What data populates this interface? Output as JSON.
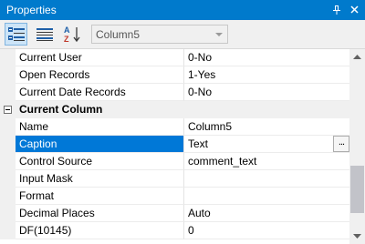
{
  "window": {
    "title": "Properties",
    "pin_icon": "pin-icon",
    "close_icon": "close-icon"
  },
  "toolbar": {
    "buttons": [
      {
        "icon": "categorized-view-icon",
        "active": true
      },
      {
        "icon": "property-pages-icon",
        "active": false
      },
      {
        "icon": "sort-alphabetical-icon",
        "active": false
      }
    ],
    "object_selector": {
      "value": "Column5",
      "options_visible": false
    }
  },
  "grid": {
    "rows": [
      {
        "type": "property",
        "name": "Current User",
        "value": "0-No"
      },
      {
        "type": "property",
        "name": "Open Records",
        "value": "1-Yes"
      },
      {
        "type": "property",
        "name": "Current Date Records",
        "value": "0-No"
      },
      {
        "type": "category",
        "name": "Current Column",
        "expanded": true
      },
      {
        "type": "property",
        "name": "Name",
        "value": "Column5"
      },
      {
        "type": "property",
        "name": "Caption",
        "value": "Text",
        "selected": true,
        "has_ellipsis": true,
        "ellipsis_label": "..."
      },
      {
        "type": "property",
        "name": "Control Source",
        "value": "comment_text"
      },
      {
        "type": "property",
        "name": "Input Mask",
        "value": ""
      },
      {
        "type": "property",
        "name": "Format",
        "value": ""
      },
      {
        "type": "property",
        "name": "Decimal Places",
        "value": "Auto"
      },
      {
        "type": "property",
        "name": "DF(10145)",
        "value": "0"
      }
    ]
  },
  "scrollbar": {
    "position_fraction": 0.62
  },
  "colors": {
    "titlebar": "#007acc",
    "selection": "#0078d7",
    "toolbar_active": "#cce4f7"
  }
}
